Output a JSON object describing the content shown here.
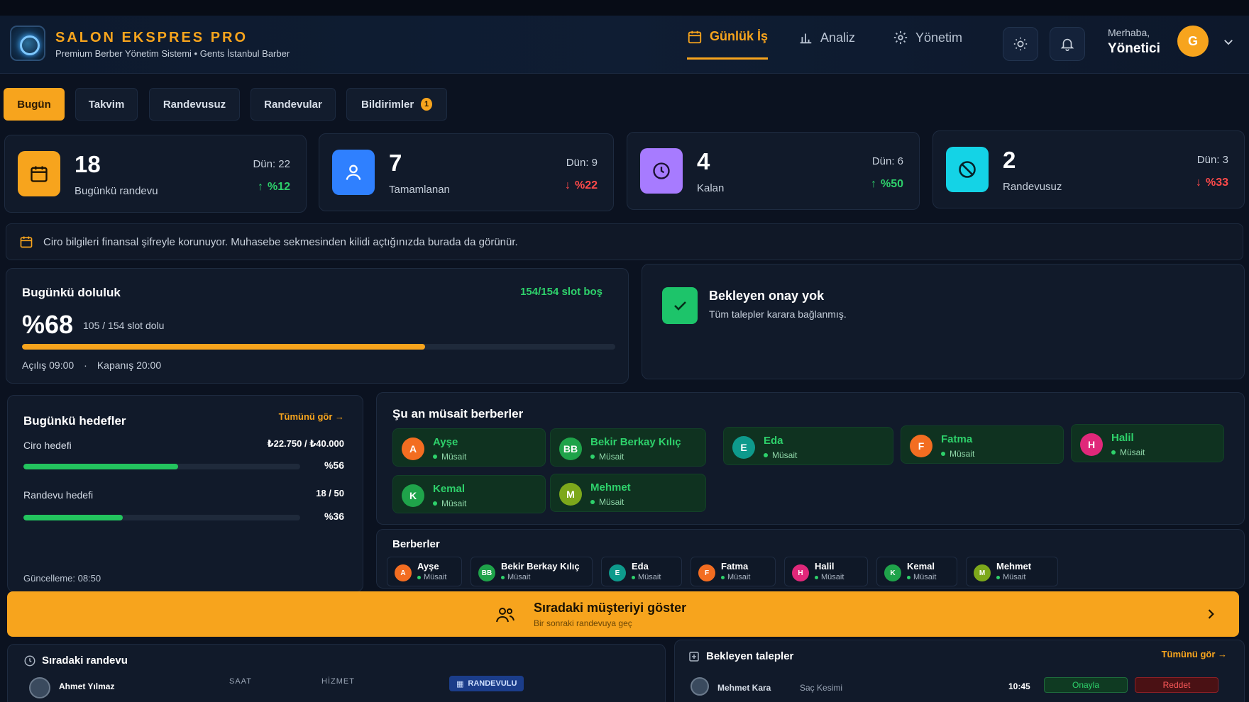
{
  "header": {
    "brand_title": "SALON EKSPRES PRO",
    "brand_subtitle": "Premium Berber Yönetim Sistemi • Gents İstanbul Barber",
    "nav": [
      {
        "label": "Günlük İş",
        "icon": "calendar-icon",
        "active": true
      },
      {
        "label": "Analiz",
        "icon": "bar-chart-icon",
        "active": false
      },
      {
        "label": "Yönetim",
        "icon": "gear-icon",
        "active": false
      }
    ],
    "greeting": "Merhaba,",
    "user_role": "Yönetici",
    "avatar_initial": "G"
  },
  "tabs": [
    {
      "label": "Bugün",
      "active": true
    },
    {
      "label": "Takvim"
    },
    {
      "label": "Randevusuz"
    },
    {
      "label": "Randevular"
    },
    {
      "label": "Bildirimler",
      "badge": "1"
    }
  ],
  "stats": [
    {
      "value": "18",
      "label": "Bugünkü randevu",
      "prev": "Dün: 22",
      "delta": "%12",
      "trend": "up",
      "color": "#f7a41d",
      "icon": "calendar-icon"
    },
    {
      "value": "7",
      "label": "Tamamlanan",
      "prev": "Dün: 9",
      "delta": "%22",
      "trend": "down",
      "color": "#2f80ff",
      "icon": "user-icon"
    },
    {
      "value": "4",
      "label": "Kalan",
      "prev": "Dün: 6",
      "delta": "%50",
      "trend": "up",
      "color": "#a77bff",
      "icon": "clock-icon"
    },
    {
      "value": "2",
      "label": "Randevusuz",
      "prev": "Dün: 3",
      "delta": "%33",
      "trend": "down",
      "color": "#14d3e6",
      "icon": "ban-icon"
    }
  ],
  "info_message": "Ciro bilgileri finansal şifreyle korunuyor. Muhasebe sekmesinden kilidi açtığınızda burada da görünür.",
  "occupancy": {
    "title": "Bugünkü doluluk",
    "free_slots": "154/154 slot boş",
    "percent_label": "%68",
    "slots_text": "105 / 154 slot dolu",
    "fill": 0.68,
    "open_time": "Açılış 09:00",
    "separator": "·",
    "close_time": "Kapanış 20:00"
  },
  "pending": {
    "title": "Bekleyen onay yok",
    "subtitle": "Tüm talepler karara bağlanmış."
  },
  "goals": {
    "title": "Bugünkü hedefler",
    "see_all": "Tümünü gör →",
    "items": [
      {
        "label": "Ciro hedefi",
        "value": "₺22.750 / ₺40.000",
        "percent": "%56",
        "fill": 0.56
      },
      {
        "label": "Randevu hedefi",
        "value": "18 / 50",
        "percent": "%36",
        "fill": 0.36
      }
    ],
    "updated": "Güncelleme: 08:50"
  },
  "available": {
    "title": "Şu an müsait berberler",
    "barbers": [
      {
        "initial": "A",
        "name": "Ayşe",
        "status": "Müsait",
        "color": "#f36d21"
      },
      {
        "initial": "BB",
        "name": "Bekir Berkay Kılıç",
        "status": "Müsait",
        "color": "#1fa34a"
      },
      {
        "initial": "E",
        "name": "Eda",
        "status": "Müsait",
        "color": "#0e9a8c"
      },
      {
        "initial": "F",
        "name": "Fatma",
        "status": "Müsait",
        "color": "#f36d21"
      },
      {
        "initial": "H",
        "name": "Halil",
        "status": "Müsait",
        "color": "#e0287a"
      },
      {
        "initial": "K",
        "name": "Kemal",
        "status": "Müsait",
        "color": "#1fa34a"
      },
      {
        "initial": "M",
        "name": "Mehmet",
        "status": "Müsait",
        "color": "#7da81b"
      }
    ]
  },
  "barbers": {
    "title": "Berberler",
    "items": [
      {
        "initial": "A",
        "name": "Ayşe",
        "status": "Müsait",
        "color": "#f36d21"
      },
      {
        "initial": "BB",
        "name": "Bekir Berkay Kılıç",
        "status": "Müsait",
        "color": "#1fa34a"
      },
      {
        "initial": "E",
        "name": "Eda",
        "status": "Müsait",
        "color": "#0e9a8c"
      },
      {
        "initial": "F",
        "name": "Fatma",
        "status": "Müsait",
        "color": "#f36d21"
      },
      {
        "initial": "H",
        "name": "Halil",
        "status": "Müsait",
        "color": "#e0287a"
      },
      {
        "initial": "K",
        "name": "Kemal",
        "status": "Müsait",
        "color": "#1fa34a"
      },
      {
        "initial": "M",
        "name": "Mehmet",
        "status": "Müsait",
        "color": "#7da81b"
      }
    ]
  },
  "cta": {
    "title": "Sıradaki müşteriyi göster",
    "subtitle": "Bir sonraki randevuya geç"
  },
  "next_appointment": {
    "title": "Sıradaki randevu",
    "customer": "Ahmet Yılmaz",
    "col_time": "SAAT",
    "col_service": "HİZMET",
    "tag": "RANDEVULU"
  },
  "requests": {
    "title": "Bekleyen talepler",
    "see_all": "Tümünü gör →",
    "row": {
      "name": "Mehmet Kara",
      "service": "Saç Kesimi",
      "time": "10:45",
      "approve": "Onayla",
      "reject": "Reddet"
    }
  },
  "colors": {
    "accent": "#f7a41d",
    "success": "#2ed16b",
    "danger": "#ff4a4a",
    "background": "#0b1220"
  }
}
